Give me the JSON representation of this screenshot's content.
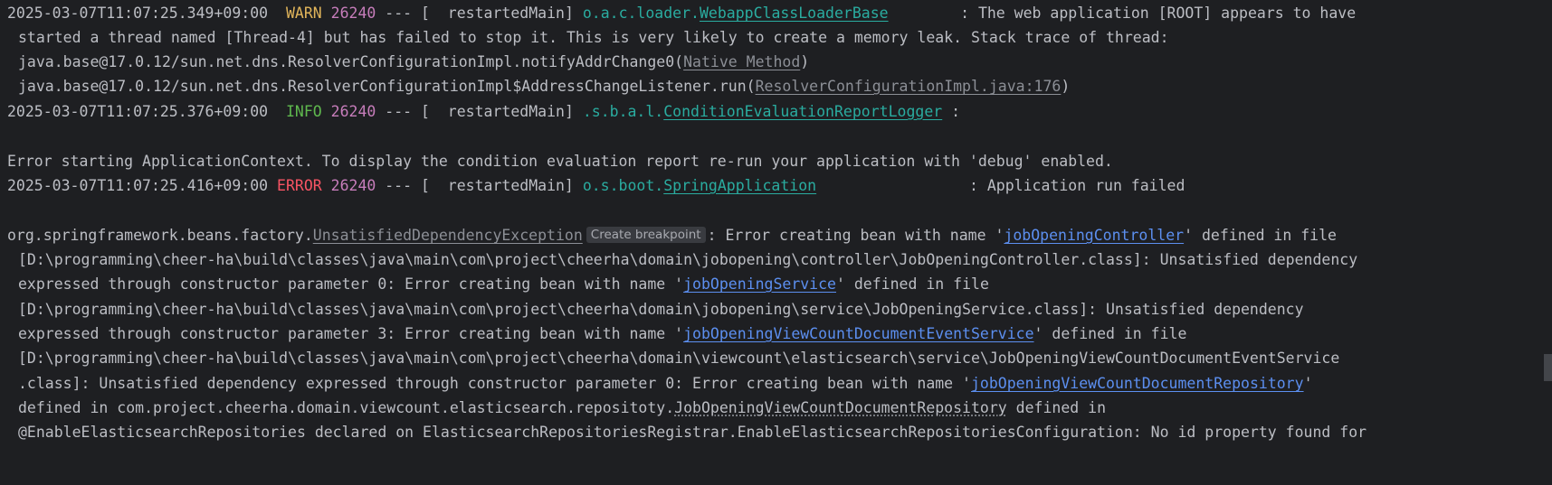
{
  "lines": [
    {
      "ts": "2025-03-07T11:07:25.349+09:00",
      "level": "WARN",
      "pid": "26240",
      "sep": " --- [ ",
      "thread": " restartedMain] ",
      "logger_prefix": "o.a.c.loader.",
      "logger_link": "WebappClassLoaderBase",
      "msg": " : The web application [ROOT] appears to have"
    },
    {
      "text": "started a thread named [Thread-4] but has failed to stop it. This is very likely to create a memory leak. Stack trace of thread:"
    },
    {
      "prefix": "java.base@17.0.12/sun.net.dns.ResolverConfigurationImpl.notifyAddrChange0(",
      "link": "Native Method",
      "suffix": ")"
    },
    {
      "prefix": "java.base@17.0.12/sun.net.dns.ResolverConfigurationImpl$AddressChangeListener.run(",
      "link": "ResolverConfigurationImpl.java:176",
      "suffix": ")"
    },
    {
      "ts": "2025-03-07T11:07:25.376+09:00",
      "level": "INFO",
      "pid": "26240",
      "sep": " --- [ ",
      "thread": " restartedMain] ",
      "logger_prefix": ".s.b.a.l.",
      "logger_link": "ConditionEvaluationReportLogger",
      "msg": " :"
    },
    {
      "text": "Error starting ApplicationContext. To display the condition evaluation report re-run your application with 'debug' enabled."
    },
    {
      "ts": "2025-03-07T11:07:25.416+09:00",
      "level": "ERROR",
      "pid": "26240",
      "sep": " --- [ ",
      "thread": " restartedMain] ",
      "logger_prefix": "o.s.boot.",
      "logger_link": "SpringApplication",
      "msg": " : Application run failed"
    },
    {
      "prefix": "org.springframework.beans.factory.",
      "exception": "UnsatisfiedDependencyException",
      "chip": "Create breakpoint",
      "mid": ": Error creating bean with name '",
      "link": "jobOpeningController",
      "suffix": "' defined in file"
    },
    {
      "text": "[D:\\programming\\cheer-ha\\build\\classes\\java\\main\\com\\project\\cheerha\\domain\\jobopening\\controller\\JobOpeningController.class]: Unsatisfied dependency"
    },
    {
      "prefix": "expressed through constructor parameter 0: Error creating bean with name '",
      "link": "jobOpeningService",
      "suffix": "' defined in file"
    },
    {
      "text": "[D:\\programming\\cheer-ha\\build\\classes\\java\\main\\com\\project\\cheerha\\domain\\jobopening\\service\\JobOpeningService.class]: Unsatisfied dependency"
    },
    {
      "prefix": "expressed through constructor parameter 3: Error creating bean with name '",
      "link": "jobOpeningViewCountDocumentEventService",
      "suffix": "' defined in file"
    },
    {
      "text": "[D:\\programming\\cheer-ha\\build\\classes\\java\\main\\com\\project\\cheerha\\domain\\viewcount\\elasticsearch\\service\\JobOpeningViewCountDocumentEventService"
    },
    {
      "prefix": ".class]: Unsatisfied dependency expressed through constructor parameter 0: Error creating bean with name '",
      "link": "jobOpeningViewCountDocumentRepository",
      "suffix": "'"
    },
    {
      "prefix": "defined in com.project.cheerha.domain.viewcount.elasticsearch.repositoty.",
      "dotted": "JobOpeningViewCountDocumentRepository",
      "suffix": " defined in"
    },
    {
      "text": "@EnableElasticsearchRepositories declared on ElasticsearchRepositoriesRegistrar.EnableElasticsearchRepositoriesConfiguration: No id property found for"
    }
  ],
  "colors": {
    "background": "#1e1f22",
    "text": "#bcbec4",
    "warn": "#e0b45a",
    "info": "#5fb84e",
    "error": "#f75464",
    "pid": "#c77dbb",
    "logger": "#2aaca0",
    "link": "#5c8ff0"
  }
}
